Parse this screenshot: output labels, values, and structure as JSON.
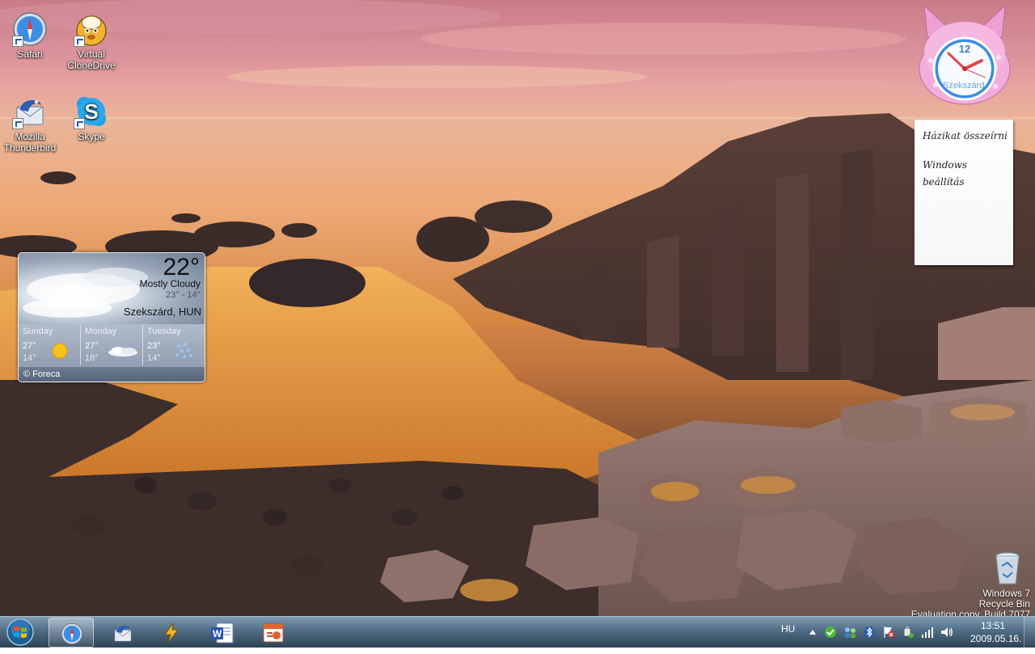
{
  "desktop": {
    "icons": [
      {
        "label": "Safari",
        "icon": "safari-icon"
      },
      {
        "label": "Virtual CloneDrive",
        "icon": "virtual-clonedrive-icon"
      },
      {
        "label": "Mozilla Thunderbird",
        "icon": "thunderbird-icon"
      },
      {
        "label": "Skype",
        "icon": "skype-icon"
      }
    ],
    "recycle_bin": {
      "label": "Recycle Bin",
      "icon": "recycle-bin-icon"
    },
    "watermark": {
      "line1": "Windows 7",
      "line2": "Evaluation copy. Build 7077"
    }
  },
  "weather_gadget": {
    "temperature": "22°",
    "condition": "Mostly Cloudy",
    "range": "23° - 14°",
    "location": "Szekszárd, HUN",
    "forecast": [
      {
        "day": "Sunday",
        "high": "27°",
        "low": "14°",
        "icon": "sunny-icon"
      },
      {
        "day": "Monday",
        "high": "27°",
        "low": "16°",
        "icon": "cloudy-icon"
      },
      {
        "day": "Tuesday",
        "high": "23°",
        "low": "14°",
        "icon": "rain-icon"
      }
    ],
    "credit": "© Foreca"
  },
  "clock_gadget": {
    "city": "Szekszárd",
    "numeral": "12",
    "time": "13:51"
  },
  "sticky_note": {
    "lines": [
      "Házikat összeírni",
      "Windows",
      "beállítás"
    ]
  },
  "taskbar": {
    "start_label": "Start",
    "pinned": [
      {
        "name": "Safari",
        "icon": "safari-icon",
        "active": true
      },
      {
        "name": "Mozilla Thunderbird",
        "icon": "thunderbird-icon",
        "active": false
      },
      {
        "name": "Winamp",
        "icon": "winamp-icon",
        "active": false
      },
      {
        "name": "Microsoft Word",
        "icon": "word-icon",
        "active": false
      },
      {
        "name": "Microsoft PowerPoint",
        "icon": "powerpoint-icon",
        "active": false
      }
    ],
    "tray": {
      "language": "HU",
      "icons": [
        "show-hidden-icons-arrow",
        "security-check-icon",
        "network-users-icon",
        "bluetooth-icon",
        "action-center-icon",
        "removable-device-icon",
        "network-signal-icon",
        "volume-icon"
      ],
      "time": "13:51",
      "date": "2009.05.16."
    }
  },
  "colors": {
    "taskbar": "#3c5a74",
    "weather_panel": "#b0bccb",
    "clock_face": "#3a8ee0",
    "clock_body": "#f0a8d8"
  }
}
